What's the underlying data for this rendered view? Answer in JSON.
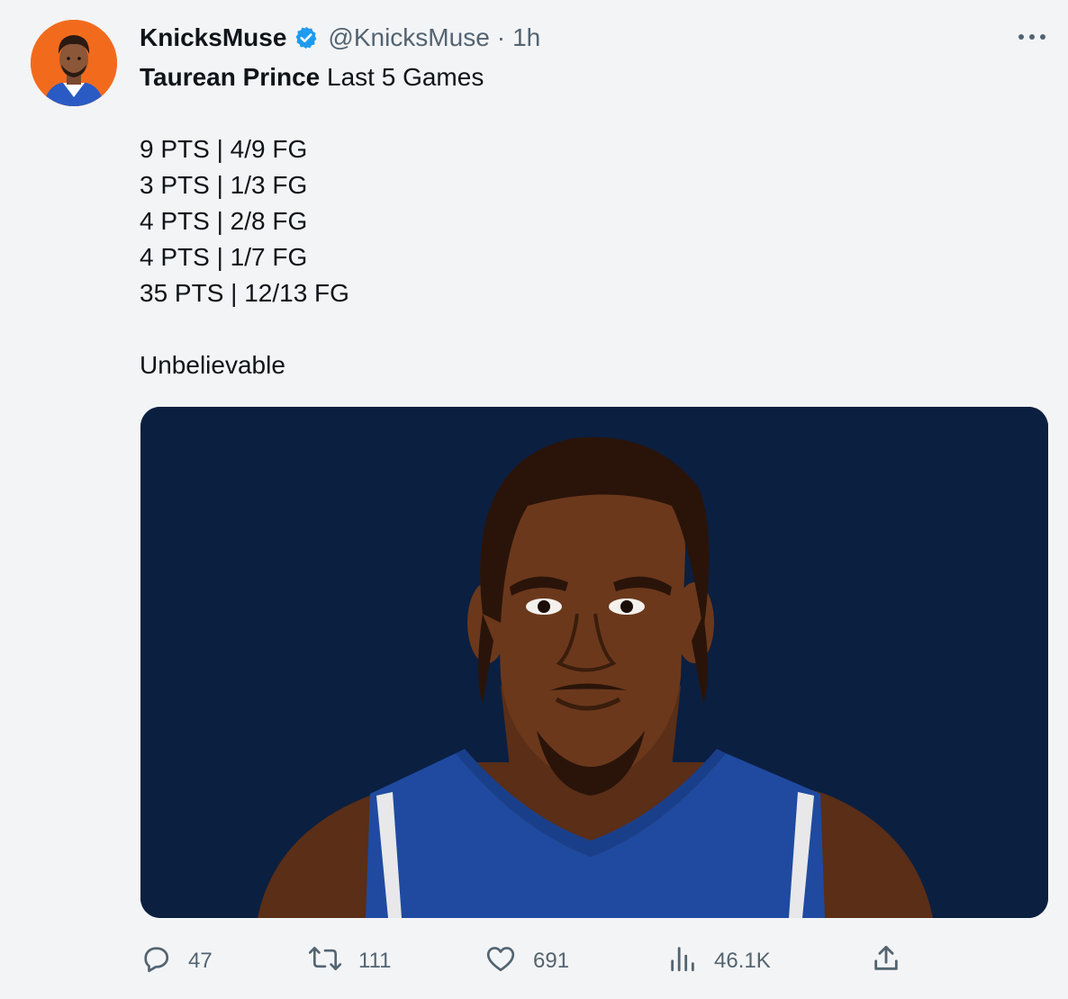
{
  "tweet": {
    "display_name": "KnicksMuse",
    "handle": "@KnicksMuse",
    "separator": "·",
    "time": "1h",
    "headline_bold": "Taurean Prince",
    "headline_rest": " Last 5 Games",
    "stat_lines": [
      "9 PTS | 4/9 FG",
      "3 PTS | 1/3 FG",
      "4 PTS | 2/8 FG",
      "4 PTS | 1/7 FG",
      "35 PTS | 12/13 FG"
    ],
    "closing": "Unbelievable"
  },
  "actions": {
    "replies": "47",
    "retweets": "111",
    "likes": "691",
    "views": "46.1K"
  },
  "icons": {
    "verified": "verified-badge-icon",
    "more": "more-options-icon",
    "reply": "reply-icon",
    "retweet": "retweet-icon",
    "like": "heart-icon",
    "views": "views-icon",
    "share": "share-icon"
  },
  "colors": {
    "avatar_background": "#f26b1d",
    "verified": "#1d9bf0",
    "media_background": "#0b1f40",
    "jersey": "#1f4aa0",
    "muted_text": "#536471"
  }
}
